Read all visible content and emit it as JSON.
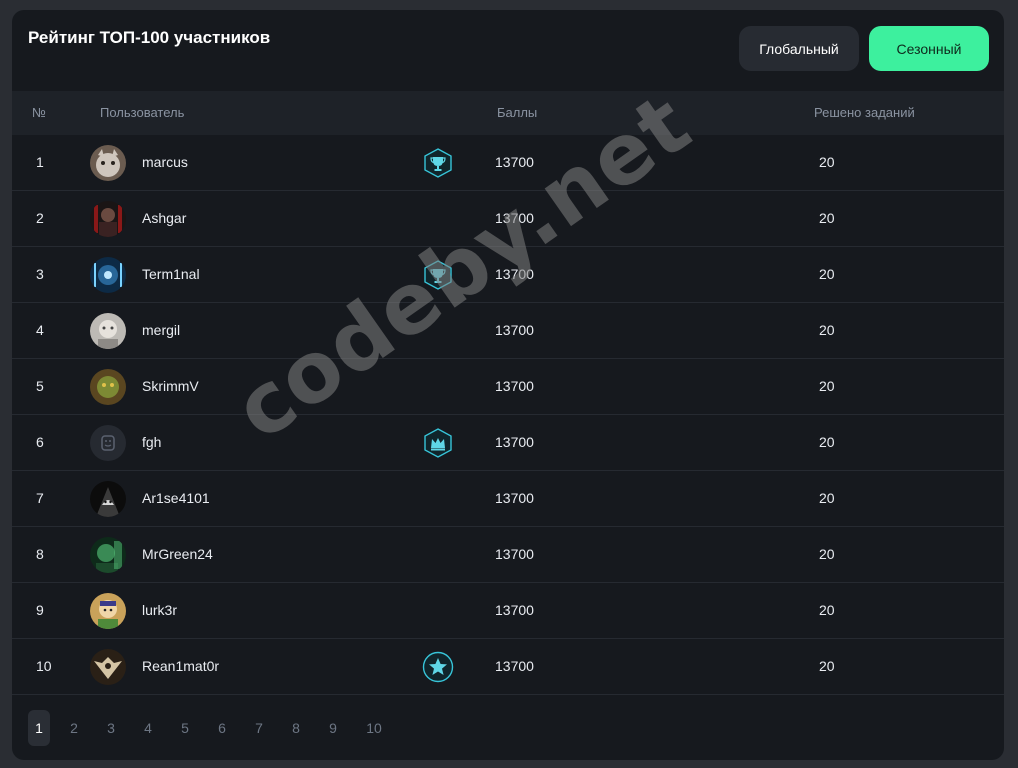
{
  "header": {
    "title": "Рейтинг ТОП-100 участников",
    "tab_global": "Глобальный",
    "tab_season": "Сезонный",
    "active_tab": "Сезонный",
    "accent_color": "#3df09e"
  },
  "table": {
    "columns": {
      "rank": "№",
      "user": "Пользователь",
      "points": "Баллы",
      "solved": "Решено заданий"
    },
    "rows": [
      {
        "rank": "1",
        "user": "marcus",
        "points": "13700",
        "solved": "20",
        "badge": "trophy-icon",
        "avatar": "cat"
      },
      {
        "rank": "2",
        "user": "Ashgar",
        "points": "13700",
        "solved": "20",
        "badge": "",
        "avatar": "dark-figure"
      },
      {
        "rank": "3",
        "user": "Term1nal",
        "points": "13700",
        "solved": "20",
        "badge": "trophy-icon",
        "avatar": "blue-tech"
      },
      {
        "rank": "4",
        "user": "mergil",
        "points": "13700",
        "solved": "20",
        "badge": "",
        "avatar": "grey-face"
      },
      {
        "rank": "5",
        "user": "SkrimmV",
        "points": "13700",
        "solved": "20",
        "badge": "",
        "avatar": "green-brown"
      },
      {
        "rank": "6",
        "user": "fgh",
        "points": "13700",
        "solved": "20",
        "badge": "crown-icon",
        "avatar": "default"
      },
      {
        "rank": "7",
        "user": "Ar1se4101",
        "points": "13700",
        "solved": "20",
        "badge": "",
        "avatar": "hooded"
      },
      {
        "rank": "8",
        "user": "MrGreen24",
        "points": "13700",
        "solved": "20",
        "badge": "",
        "avatar": "green-face"
      },
      {
        "rank": "9",
        "user": "lurk3r",
        "points": "13700",
        "solved": "20",
        "badge": "",
        "avatar": "cartoon"
      },
      {
        "rank": "10",
        "user": "Rean1mat0r",
        "points": "13700",
        "solved": "20",
        "badge": "star-icon",
        "avatar": "emblem"
      }
    ]
  },
  "pagination": {
    "pages": [
      "1",
      "2",
      "3",
      "4",
      "5",
      "6",
      "7",
      "8",
      "9",
      "10"
    ],
    "current": "1"
  },
  "watermark": "codeby.net"
}
